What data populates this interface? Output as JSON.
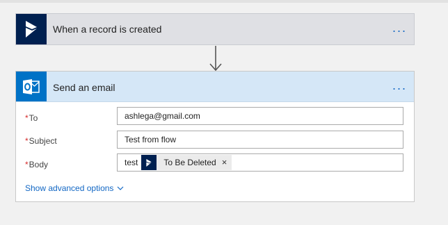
{
  "trigger": {
    "title": "When a record is created",
    "icon": "dynamics-icon",
    "more_label": "..."
  },
  "action": {
    "title": "Send an email",
    "icon": "outlook-icon",
    "more_label": "...",
    "fields": {
      "to": {
        "required_mark": "*",
        "label": "To",
        "value": "ashlega@gmail.com"
      },
      "subject": {
        "required_mark": "*",
        "label": "Subject",
        "value": "Test from flow"
      },
      "body": {
        "required_mark": "*",
        "label": "Body",
        "text": "test",
        "token": {
          "label": "To Be Deleted",
          "remove": "×",
          "icon": "dynamics-icon"
        }
      }
    },
    "advanced_label": "Show advanced options"
  },
  "colors": {
    "dynamics": "#002050",
    "outlook": "#0072c6",
    "link": "#1267c4",
    "required": "#d62b2b"
  }
}
